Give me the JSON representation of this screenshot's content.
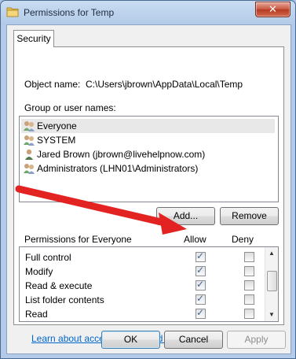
{
  "window": {
    "title": "Permissions for Temp",
    "close_glyph": "✕",
    "icon": "folder-icon"
  },
  "tabs": [
    {
      "label": "Security"
    }
  ],
  "object": {
    "label": "Object name:",
    "value": "C:\\Users\\jbrown\\AppData\\Local\\Temp"
  },
  "group_label": "Group or user names:",
  "users": [
    {
      "name": "Everyone",
      "icon": "users-group-icon",
      "selected": true
    },
    {
      "name": "SYSTEM",
      "icon": "users-group-icon",
      "selected": false
    },
    {
      "name": "Jared Brown (jbrown@livehelpnow.com)",
      "icon": "user-icon",
      "selected": false
    },
    {
      "name": "Administrators (LHN01\\Administrators)",
      "icon": "users-group-icon",
      "selected": false
    }
  ],
  "buttons": {
    "add": "Add...",
    "remove": "Remove",
    "ok": "OK",
    "cancel": "Cancel",
    "apply": "Apply"
  },
  "permissions": {
    "header": "Permissions for Everyone",
    "allow_label": "Allow",
    "deny_label": "Deny",
    "rows": [
      {
        "name": "Full control",
        "allow": true,
        "deny": false
      },
      {
        "name": "Modify",
        "allow": true,
        "deny": false
      },
      {
        "name": "Read & execute",
        "allow": true,
        "deny": false
      },
      {
        "name": "List folder contents",
        "allow": true,
        "deny": false
      },
      {
        "name": "Read",
        "allow": true,
        "deny": false
      }
    ]
  },
  "link": "Learn about access control and permissions",
  "colors": {
    "link": "#0066cc",
    "annotation_arrow": "#e32222",
    "window_frame": "#b3cbe8"
  }
}
